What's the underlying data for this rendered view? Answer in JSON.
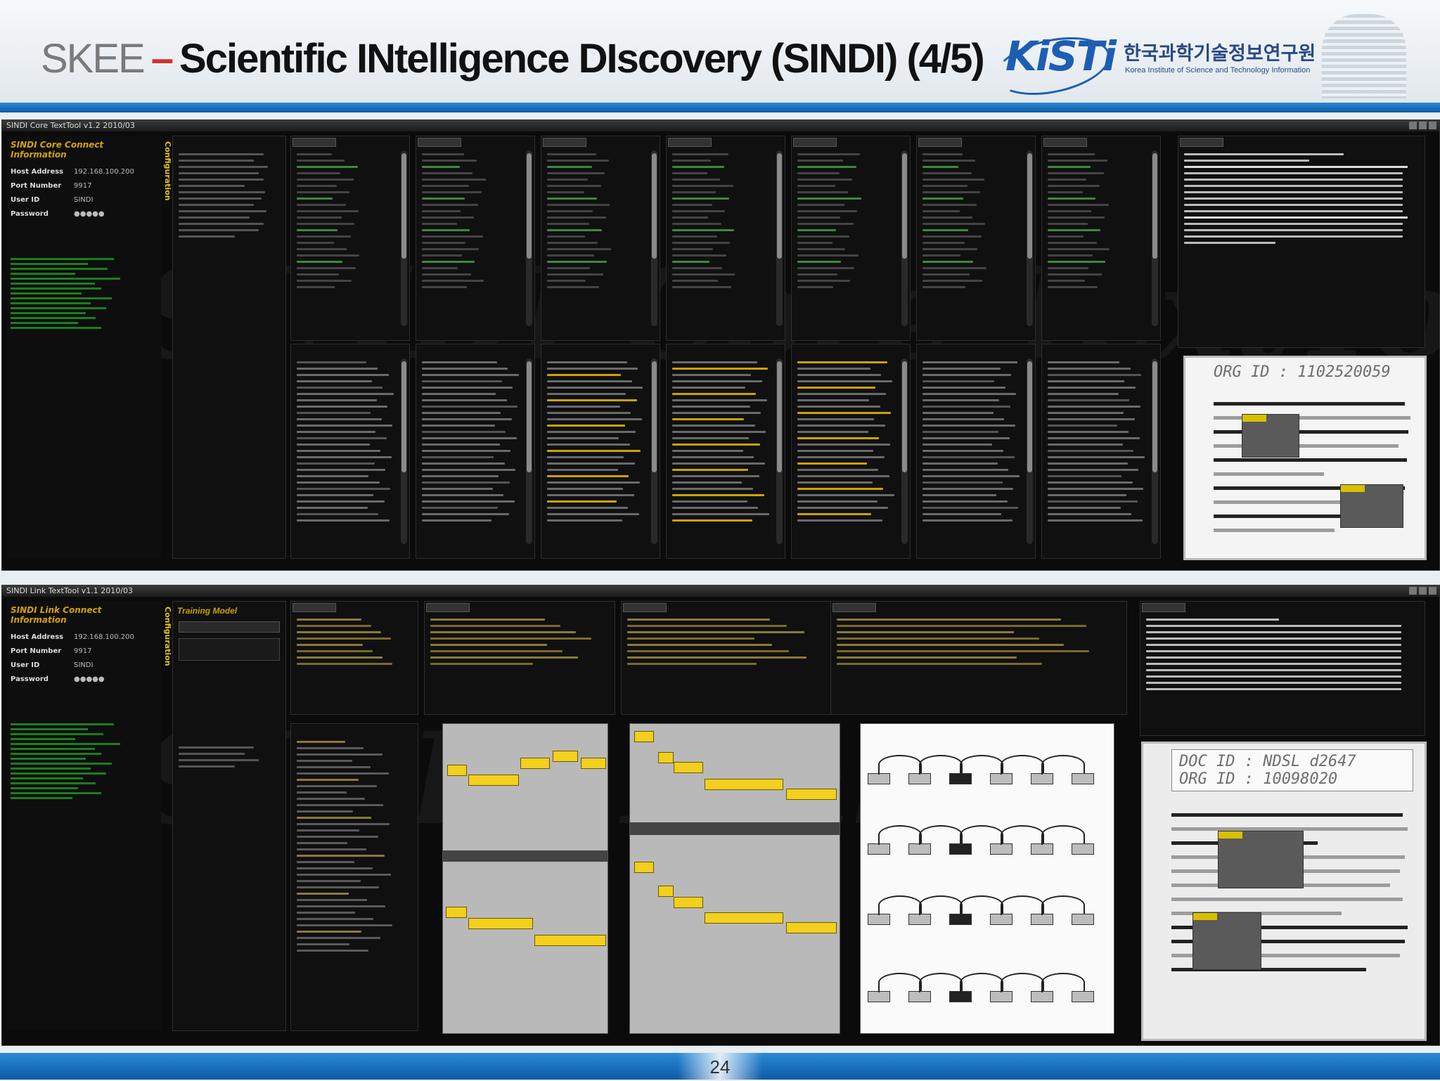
{
  "slide": {
    "title_prefix": "SKEE",
    "title_dash": "–",
    "title_main": "Scientific INtelligence DIscovery (SINDI) (4/5)",
    "logo_text": "KiSTi",
    "logo_korean": "한국과학기술정보연구원",
    "logo_english": "Korea Institute of Science and Technology Information",
    "page_number": "24"
  },
  "top_window": {
    "title": "SINDI Core TextTool v1.2 2010/03",
    "watermark": "SINDI Core TextTool",
    "connection": {
      "heading": "SINDI Core Connect Information",
      "host_label": "Host Address",
      "host_value": "192.168.100.200",
      "port_label": "Port Number",
      "port_value": "9917",
      "user_label": "User ID",
      "user_value": "SINDI",
      "password_label": "Password",
      "password_value": "●●●●●"
    },
    "side_label": "Configuration",
    "detail": {
      "org_id": "ORG ID : 1102520059"
    }
  },
  "bottom_window": {
    "title": "SINDI Link TextTool v1.1 2010/03",
    "watermark": "SINDI Link",
    "connection": {
      "heading": "SINDI Link Connect Information",
      "host_label": "Host Address",
      "host_value": "192.168.100.200",
      "port_label": "Port Number",
      "port_value": "9917",
      "user_label": "User ID",
      "user_value": "SINDI",
      "password_label": "Password",
      "password_value": "●●●●●"
    },
    "training_model": "Training Model",
    "side_label": "Configuration",
    "detail": {
      "doc_id": "DOC ID : NDSL d2647",
      "org_id": "ORG ID : 10098020"
    }
  }
}
